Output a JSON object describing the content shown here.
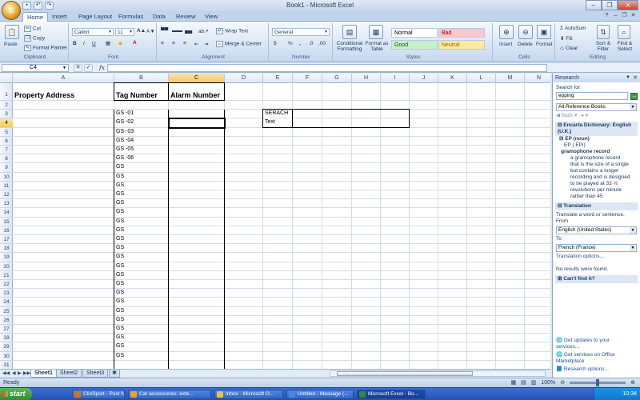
{
  "window": {
    "title": "Book1 - Microsoft Excel"
  },
  "quick_access": [
    "save-icon",
    "undo-icon",
    "redo-icon"
  ],
  "tabs": [
    "Home",
    "Insert",
    "Page Layout",
    "Formulas",
    "Data",
    "Review",
    "View"
  ],
  "active_tab": "Home",
  "ribbon": {
    "clipboard": {
      "paste": "Paste",
      "cut": "Cut",
      "copy": "Copy",
      "format_painter": "Format Painter",
      "label": "Clipboard"
    },
    "font": {
      "name": "Calibri",
      "size": "11",
      "label": "Font",
      "bold": "B",
      "italic": "I",
      "underline": "U",
      "grow": "A",
      "shrink": "A"
    },
    "alignment": {
      "wrap": "Wrap Text",
      "merge": "Merge & Center",
      "label": "Alignment"
    },
    "number": {
      "format": "General",
      "currency": "$",
      "percent": "%",
      "comma": ",",
      "label": "Number"
    },
    "styles": {
      "conditional": "Conditional Formatting",
      "format_table": "Format as Table",
      "normal": "Normal",
      "bad": "Bad",
      "good": "Good",
      "neutral": "Neutral",
      "label": "Styles"
    },
    "cells": {
      "insert": "Insert",
      "delete": "Delete",
      "format": "Format",
      "label": "Cells"
    },
    "editing": {
      "autosum": "AutoSum",
      "fill": "Fill",
      "clear": "Clear",
      "sort_filter": "Sort & Filter",
      "find_select": "Find & Select",
      "label": "Editing"
    }
  },
  "formula_bar": {
    "name_box": "C4",
    "fx": "fx",
    "value": ""
  },
  "columns": [
    "A",
    "B",
    "C",
    "D",
    "E",
    "F",
    "G",
    "H",
    "I",
    "J",
    "K",
    "L",
    "M",
    "N"
  ],
  "selected_column": "C",
  "rows": [
    "1",
    "2",
    "3",
    "4",
    "5",
    "6",
    "7",
    "8",
    "9",
    "10",
    "11",
    "12",
    "13",
    "14",
    "15",
    "16",
    "17",
    "18",
    "19",
    "20",
    "21",
    "22",
    "23",
    "24",
    "25",
    "26",
    "27",
    "28",
    "29",
    "30",
    "31"
  ],
  "selected_row": "4",
  "cells": {
    "A1": "Property Address",
    "B1": "Tag Number",
    "C1": "Alarm Number",
    "E3": "SERACH",
    "E4": "Text"
  },
  "tag_numbers": [
    "GS -01",
    "GS -02",
    "GS- 03",
    "GS -04",
    "GS -05",
    "GS -06",
    "GS",
    "GS",
    "GS",
    "GS",
    "GS",
    "GS",
    "GS",
    "GS",
    "GS",
    "GS",
    "GS",
    "GS",
    "GS",
    "GS",
    "GS",
    "GS",
    "GS",
    "GS",
    "GS",
    "GS",
    "GS",
    "GS"
  ],
  "sheets": [
    "Sheet1",
    "Sheet2",
    "Sheet3"
  ],
  "active_sheet": "Sheet1",
  "status": {
    "ready": "Ready",
    "zoom": "100%"
  },
  "research": {
    "title": "Research",
    "search_for_label": "Search for:",
    "search_value": "epping",
    "source": "All Reference Books",
    "back": "Back",
    "dictionary_header": "Encarta Dictionary: English (U.K.)",
    "entry_head": "EP (noun)",
    "pronunciation": "EP (.EPi)",
    "entry_sense": "gramophone record",
    "definition_lines": [
      "a gramophone record",
      "that is the size of a single",
      "but contains a longer",
      "recording and is designed",
      "to be played at 33 ⅓",
      "revolutions per minute",
      "rather than 45"
    ],
    "translation_header": "Translation",
    "translate_prompt": "Translate a word or sentence.",
    "from_label": "From",
    "from_value": "English (United States)",
    "to_label": "To",
    "to_value": "French (France)",
    "translation_options": "Translation options...",
    "no_results": "No results were found.",
    "cant_find": "Can't find it?",
    "links": [
      "Get updates to your services...",
      "Get services on Office Marketplace",
      "Research options..."
    ]
  },
  "taskbar": {
    "start": "start",
    "items": [
      {
        "label": "ClioSport - Post Ne...",
        "color": "#e06a1b"
      },
      {
        "label": "Car accessories: exte...",
        "color": "#f0a020"
      },
      {
        "label": "Inbox - Microsoft O...",
        "color": "#f0c040"
      },
      {
        "label": "Untitled - Message (...",
        "color": "#4a86d8"
      },
      {
        "label": "Microsoft Excel - Bo...",
        "color": "#2e8b3e"
      }
    ],
    "clock": "10:34"
  }
}
